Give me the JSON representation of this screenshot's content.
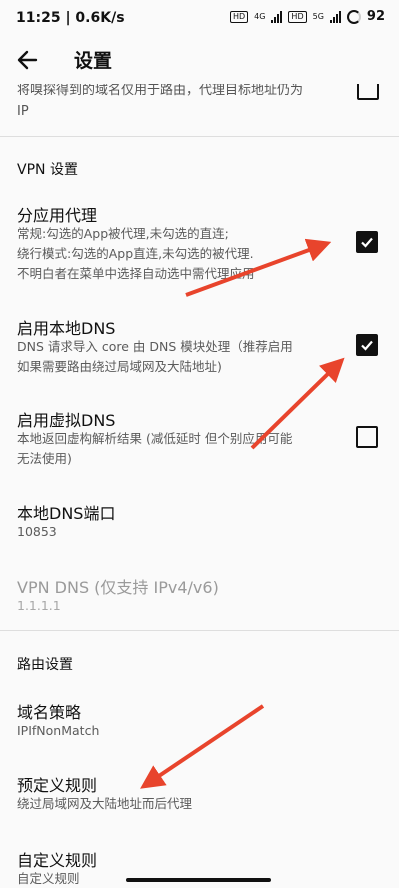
{
  "status_bar": {
    "time_speed": "11:25 | 0.6K/s",
    "hd1": "HD",
    "net1": "4G",
    "hd2": "HD",
    "net2": "5G",
    "battery": "92"
  },
  "app_bar": {
    "title": "设置"
  },
  "cut_off_item": {
    "line1": "将嗅探得到的域名仅用于路由，代理目标地址仍为",
    "line2": "IP",
    "checked": false
  },
  "vpn_section": {
    "header": "VPN 设置",
    "items": [
      {
        "title": "分应用代理",
        "sub": [
          "常规:勾选的App被代理,未勾选的直连;",
          "绕行模式:勾选的App直连,未勾选的被代理.",
          "不明白者在菜单中选择自动选中需代理应用"
        ],
        "checked": true
      },
      {
        "title": "启用本地DNS",
        "sub": [
          "DNS 请求导入 core 由 DNS 模块处理（推荐启用",
          "如果需要路由绕过局域网及大陆地址)"
        ],
        "checked": true
      },
      {
        "title": "启用虚拟DNS",
        "sub": [
          "本地返回虚构解析结果 (减低延时 但个别应用可能",
          "无法使用)"
        ],
        "checked": false
      },
      {
        "title": "本地DNS端口",
        "sub": [
          "10853"
        ]
      },
      {
        "title": "VPN DNS (仅支持 IPv4/v6)",
        "sub": [
          "1.1.1.1"
        ],
        "disabled": true
      }
    ]
  },
  "routing_section": {
    "header": "路由设置",
    "items": [
      {
        "title": "域名策略",
        "sub": [
          "IPIfNonMatch"
        ]
      },
      {
        "title": "预定义规则",
        "sub": [
          "绕过局域网及大陆地址而后代理"
        ]
      },
      {
        "title": "自定义规则",
        "sub": [
          "自定义规则"
        ]
      }
    ]
  },
  "colors": {
    "arrow": "#e8442c",
    "background": "#fafafa",
    "divider": "#dedede"
  }
}
